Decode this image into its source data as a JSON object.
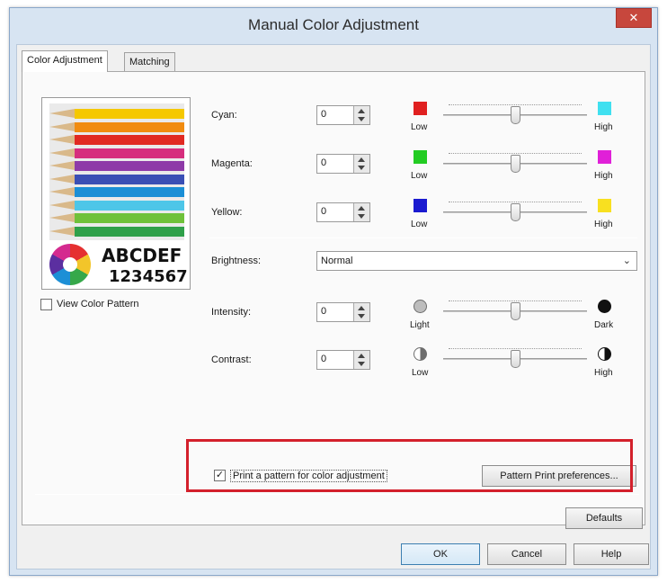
{
  "window": {
    "title": "Manual Color Adjustment",
    "close_glyph": "✕"
  },
  "tabs": [
    {
      "label": "Color Adjustment",
      "active": true
    },
    {
      "label": "Matching",
      "active": false
    }
  ],
  "preview": {
    "text_letters": "ABCDEF",
    "text_numbers": "1234567",
    "pencil_colors": [
      "#f5c800",
      "#f18c10",
      "#e12a22",
      "#d62e7d",
      "#8e3aa8",
      "#3a4fb5",
      "#1b8fd6",
      "#4ec6e8",
      "#6fc13a",
      "#2fa04a"
    ]
  },
  "view_color_pattern": {
    "label": "View Color Pattern",
    "checked": false
  },
  "color_rows": [
    {
      "label": "Cyan:",
      "value": "0",
      "low_label": "Low",
      "high_label": "High",
      "low_color": "#e02020",
      "high_color": "#40e0f0",
      "level": 0.5
    },
    {
      "label": "Magenta:",
      "value": "0",
      "low_label": "Low",
      "high_label": "High",
      "low_color": "#22cc22",
      "high_color": "#e020d8",
      "level": 0.5
    },
    {
      "label": "Yellow:",
      "value": "0",
      "low_label": "Low",
      "high_label": "High",
      "low_color": "#1a1ad0",
      "high_color": "#f8e020",
      "level": 0.5
    }
  ],
  "brightness": {
    "label": "Brightness:",
    "value": "Normal"
  },
  "intensity": {
    "label": "Intensity:",
    "value": "0",
    "low_label": "Light",
    "high_label": "Dark",
    "level": 0.5
  },
  "contrast": {
    "label": "Contrast:",
    "value": "0",
    "low_label": "Low",
    "high_label": "High",
    "level": 0.5
  },
  "print_pattern": {
    "label": "Print a pattern for color adjustment",
    "checked": true
  },
  "buttons": {
    "pattern_print_preferences": "Pattern Print preferences...",
    "defaults": "Defaults",
    "ok": "OK",
    "cancel": "Cancel",
    "help": "Help"
  },
  "colors": {
    "highlight_box": "#d3202b",
    "title_bar": "#d7e4f2",
    "close_button": "#c7473d"
  }
}
